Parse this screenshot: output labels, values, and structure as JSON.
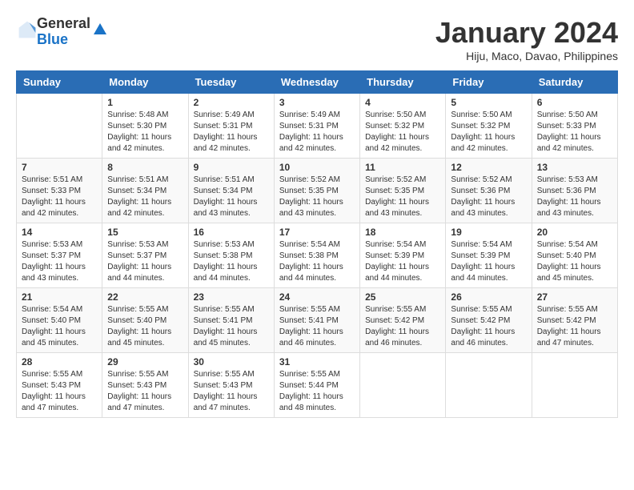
{
  "logo": {
    "general": "General",
    "blue": "Blue"
  },
  "header": {
    "title": "January 2024",
    "subtitle": "Hiju, Maco, Davao, Philippines"
  },
  "days_of_week": [
    "Sunday",
    "Monday",
    "Tuesday",
    "Wednesday",
    "Thursday",
    "Friday",
    "Saturday"
  ],
  "weeks": [
    [
      {
        "day": null,
        "info": null
      },
      {
        "day": "1",
        "sunrise": "5:48 AM",
        "sunset": "5:30 PM",
        "daylight": "11 hours and 42 minutes."
      },
      {
        "day": "2",
        "sunrise": "5:49 AM",
        "sunset": "5:31 PM",
        "daylight": "11 hours and 42 minutes."
      },
      {
        "day": "3",
        "sunrise": "5:49 AM",
        "sunset": "5:31 PM",
        "daylight": "11 hours and 42 minutes."
      },
      {
        "day": "4",
        "sunrise": "5:50 AM",
        "sunset": "5:32 PM",
        "daylight": "11 hours and 42 minutes."
      },
      {
        "day": "5",
        "sunrise": "5:50 AM",
        "sunset": "5:32 PM",
        "daylight": "11 hours and 42 minutes."
      },
      {
        "day": "6",
        "sunrise": "5:50 AM",
        "sunset": "5:33 PM",
        "daylight": "11 hours and 42 minutes."
      }
    ],
    [
      {
        "day": "7",
        "sunrise": "5:51 AM",
        "sunset": "5:33 PM",
        "daylight": "11 hours and 42 minutes."
      },
      {
        "day": "8",
        "sunrise": "5:51 AM",
        "sunset": "5:34 PM",
        "daylight": "11 hours and 42 minutes."
      },
      {
        "day": "9",
        "sunrise": "5:51 AM",
        "sunset": "5:34 PM",
        "daylight": "11 hours and 43 minutes."
      },
      {
        "day": "10",
        "sunrise": "5:52 AM",
        "sunset": "5:35 PM",
        "daylight": "11 hours and 43 minutes."
      },
      {
        "day": "11",
        "sunrise": "5:52 AM",
        "sunset": "5:35 PM",
        "daylight": "11 hours and 43 minutes."
      },
      {
        "day": "12",
        "sunrise": "5:52 AM",
        "sunset": "5:36 PM",
        "daylight": "11 hours and 43 minutes."
      },
      {
        "day": "13",
        "sunrise": "5:53 AM",
        "sunset": "5:36 PM",
        "daylight": "11 hours and 43 minutes."
      }
    ],
    [
      {
        "day": "14",
        "sunrise": "5:53 AM",
        "sunset": "5:37 PM",
        "daylight": "11 hours and 43 minutes."
      },
      {
        "day": "15",
        "sunrise": "5:53 AM",
        "sunset": "5:37 PM",
        "daylight": "11 hours and 44 minutes."
      },
      {
        "day": "16",
        "sunrise": "5:53 AM",
        "sunset": "5:38 PM",
        "daylight": "11 hours and 44 minutes."
      },
      {
        "day": "17",
        "sunrise": "5:54 AM",
        "sunset": "5:38 PM",
        "daylight": "11 hours and 44 minutes."
      },
      {
        "day": "18",
        "sunrise": "5:54 AM",
        "sunset": "5:39 PM",
        "daylight": "11 hours and 44 minutes."
      },
      {
        "day": "19",
        "sunrise": "5:54 AM",
        "sunset": "5:39 PM",
        "daylight": "11 hours and 44 minutes."
      },
      {
        "day": "20",
        "sunrise": "5:54 AM",
        "sunset": "5:40 PM",
        "daylight": "11 hours and 45 minutes."
      }
    ],
    [
      {
        "day": "21",
        "sunrise": "5:54 AM",
        "sunset": "5:40 PM",
        "daylight": "11 hours and 45 minutes."
      },
      {
        "day": "22",
        "sunrise": "5:55 AM",
        "sunset": "5:40 PM",
        "daylight": "11 hours and 45 minutes."
      },
      {
        "day": "23",
        "sunrise": "5:55 AM",
        "sunset": "5:41 PM",
        "daylight": "11 hours and 45 minutes."
      },
      {
        "day": "24",
        "sunrise": "5:55 AM",
        "sunset": "5:41 PM",
        "daylight": "11 hours and 46 minutes."
      },
      {
        "day": "25",
        "sunrise": "5:55 AM",
        "sunset": "5:42 PM",
        "daylight": "11 hours and 46 minutes."
      },
      {
        "day": "26",
        "sunrise": "5:55 AM",
        "sunset": "5:42 PM",
        "daylight": "11 hours and 46 minutes."
      },
      {
        "day": "27",
        "sunrise": "5:55 AM",
        "sunset": "5:42 PM",
        "daylight": "11 hours and 47 minutes."
      }
    ],
    [
      {
        "day": "28",
        "sunrise": "5:55 AM",
        "sunset": "5:43 PM",
        "daylight": "11 hours and 47 minutes."
      },
      {
        "day": "29",
        "sunrise": "5:55 AM",
        "sunset": "5:43 PM",
        "daylight": "11 hours and 47 minutes."
      },
      {
        "day": "30",
        "sunrise": "5:55 AM",
        "sunset": "5:43 PM",
        "daylight": "11 hours and 47 minutes."
      },
      {
        "day": "31",
        "sunrise": "5:55 AM",
        "sunset": "5:44 PM",
        "daylight": "11 hours and 48 minutes."
      },
      {
        "day": null,
        "info": null
      },
      {
        "day": null,
        "info": null
      },
      {
        "day": null,
        "info": null
      }
    ]
  ]
}
